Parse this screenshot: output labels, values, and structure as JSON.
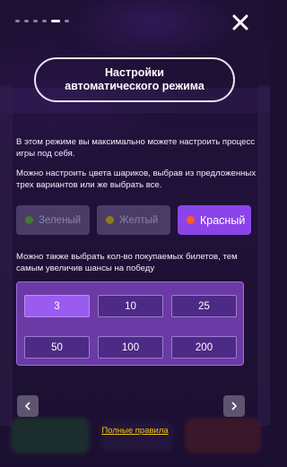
{
  "pagination": {
    "total": 6,
    "active_index": 4
  },
  "title": {
    "line1": "Настройки",
    "line2": "автоматического режима"
  },
  "description": {
    "p1": "В этом режиме вы максимально можете настроить процесс игры под себя.",
    "p2": "Можно настроить цвета шариков, выбрав из предложенных трех вариантов или же выбрать все.",
    "p3": "Можно также выбрать кол-во покупаемых билетов, тем самым увеличив шансы на победу"
  },
  "colors": [
    {
      "label": "Зеленый",
      "dot_color": "#3f7a2e",
      "selected": false
    },
    {
      "label": "Желтый",
      "dot_color": "#8c7a1e",
      "selected": false
    },
    {
      "label": "Красный",
      "dot_color": "#ff5a1f",
      "selected": true
    }
  ],
  "tickets": {
    "options": [
      "3",
      "10",
      "25",
      "50",
      "100",
      "200"
    ],
    "selected": "3"
  },
  "footer": {
    "rules_link": "Полные правила"
  },
  "accent_colors": {
    "primary": "#8b44e8",
    "link": "#f0c419"
  }
}
